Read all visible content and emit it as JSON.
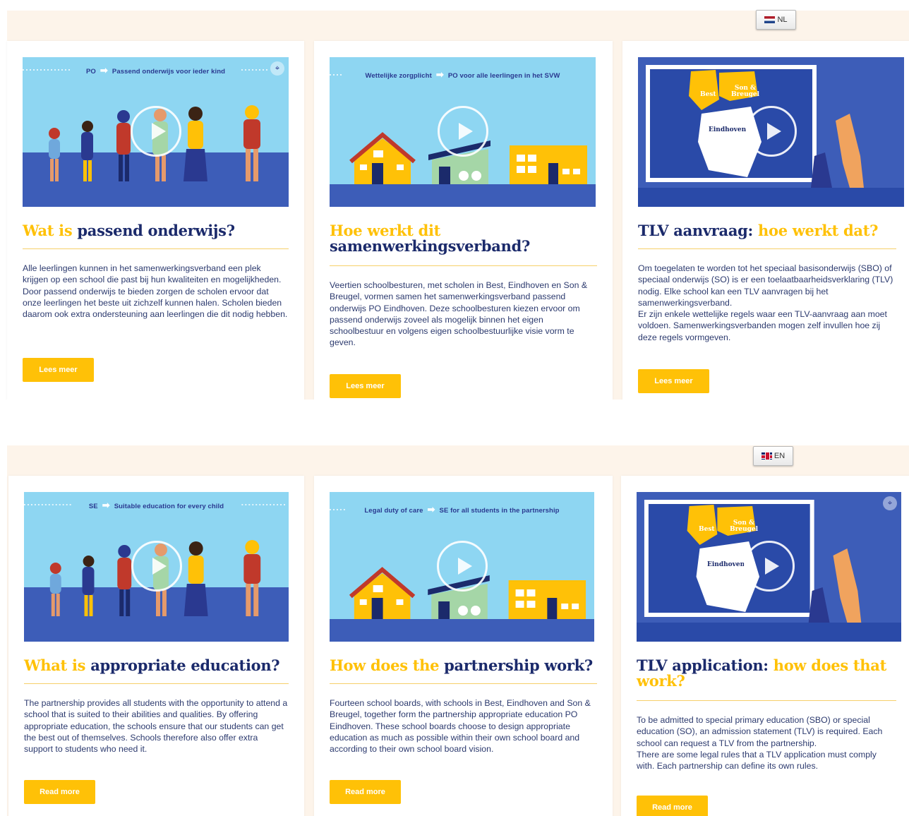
{
  "nl": {
    "lang_label": "NL",
    "cards": [
      {
        "banner_left": "PO",
        "banner_right": "Passend onderwijs voor ieder kind",
        "title_a": "Wat is ",
        "title_b": "passend onderwijs?",
        "text": "Alle leerlingen kunnen in het samenwerkingsverband een plek krijgen op een school die past bij hun kwaliteiten en mogelijkheden. Door passend onderwijs te bieden zorgen de scholen ervoor dat onze leerlingen het beste uit zichzelf kunnen halen. Scholen bieden daarom ook extra ondersteuning aan leerlingen die dit nodig hebben.",
        "button": "Lees meer"
      },
      {
        "banner_left": "Wettelijke zorgplicht",
        "banner_right": "PO voor alle leerlingen in het SVW",
        "title_a": "Hoe werkt dit",
        "title_b": "samenwerkingsverband?",
        "text": "Veertien schoolbesturen, met scholen in Best, Eindhoven en Son & Breugel, vormen samen het samenwerkingsverband passend onderwijs PO Eindhoven. Deze schoolbesturen kiezen ervoor om passend onderwijs zoveel als mogelijk binnen het eigen schoolbestuur en volgens eigen schoolbestuurlijke visie vorm te geven.",
        "button": "Lees meer"
      },
      {
        "map_labels": [
          "Best",
          "Son &",
          "Breugel",
          "Eindhoven"
        ],
        "title_a": "TLV aanvraag: ",
        "title_b": "hoe werkt dat?",
        "text": "Om toegelaten te worden tot het speciaal basisonderwijs (SBO) of speciaal onderwijs (SO) is er een toelaatbaarheidsverklaring (TLV) nodig. Elke school kan een TLV aanvragen bij het samenwerkingsverband.\nEr zijn enkele wettelijke regels waar een TLV-aanvraag aan moet voldoen. Samenwerkingsverbanden mogen zelf invullen hoe zij deze regels vormgeven.",
        "button": "Lees meer"
      }
    ]
  },
  "en": {
    "lang_label": "EN",
    "cards": [
      {
        "banner_left": "SE",
        "banner_right": "Suitable education for every child",
        "title_a": "What is ",
        "title_b": "appropriate education?",
        "text": "The partnership provides all students with the opportunity to attend a school that is suited to their abilities and qualities. By offering appropriate education, the schools ensure that our students can get the best out of themselves. Schools therefore also offer extra support to students who need it.",
        "button": "Read more"
      },
      {
        "banner_left": "Legal duty of care",
        "banner_right": "SE for all students in the partnership",
        "title_a": "How does the ",
        "title_b": "partnership work?",
        "text": "Fourteen school boards, with schools in Best, Eindhoven and Son & Breugel, together form the partnership appropriate education PO Eindhoven. These school boards choose to design appropriate education as much as possible within their own school board and according to their own school board vision.",
        "button": "Read more"
      },
      {
        "map_labels": [
          "Best",
          "Son &",
          "Breugel",
          "Eindhoven"
        ],
        "title_a": "TLV application: ",
        "title_b": "how does that work?",
        "text": "To be admitted to special primary education (SBO) or special education (SO), an admission statement (TLV) is required. Each school can request a TLV from the partnership.\nThere are some legal rules that a TLV application must comply with. Each partnership can define its own rules.",
        "button": "Read more"
      }
    ]
  },
  "icons": {
    "play": "play-icon",
    "scan": "scan-icon",
    "flag_nl": "flag-nl-icon",
    "flag_gb": "flag-gb-icon"
  },
  "colors": {
    "accent_yellow": "#ffc107",
    "navy": "#1b2a6b",
    "sky": "#8ed6f2",
    "ground_blue": "#3d5db8",
    "cream_band": "#fdf4ea"
  }
}
